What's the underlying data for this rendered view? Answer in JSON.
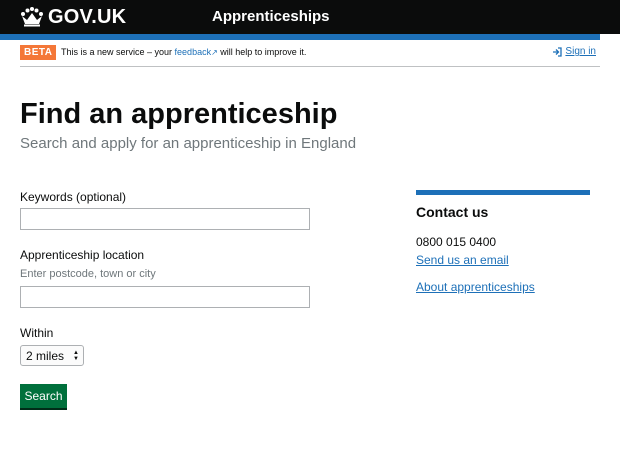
{
  "header": {
    "logo_text": "GOV.UK",
    "service_name": "Apprenticeships"
  },
  "phase_banner": {
    "tag": "BETA",
    "text_before": "This is a new service – your ",
    "link_text": "feedback",
    "text_after": " will help to improve it.",
    "sign_in": "Sign in"
  },
  "main": {
    "title": "Find an apprenticeship",
    "subtitle": "Search and apply for an apprenticeship in England"
  },
  "form": {
    "keywords_label": "Keywords (optional)",
    "keywords_value": "",
    "location_label": "Apprenticeship location",
    "location_hint": "Enter postcode, town or city",
    "location_value": "",
    "within_label": "Within",
    "within_selected": "2 miles",
    "search_button": "Search"
  },
  "contact": {
    "title": "Contact us",
    "phone": "0800 015 0400",
    "email_link": "Send us an email",
    "about_link": "About apprenticeships"
  },
  "colors": {
    "header_bg": "#0b0c0c",
    "brand_blue": "#1d70b8",
    "beta_orange": "#f47738",
    "button_green": "#00703c"
  }
}
